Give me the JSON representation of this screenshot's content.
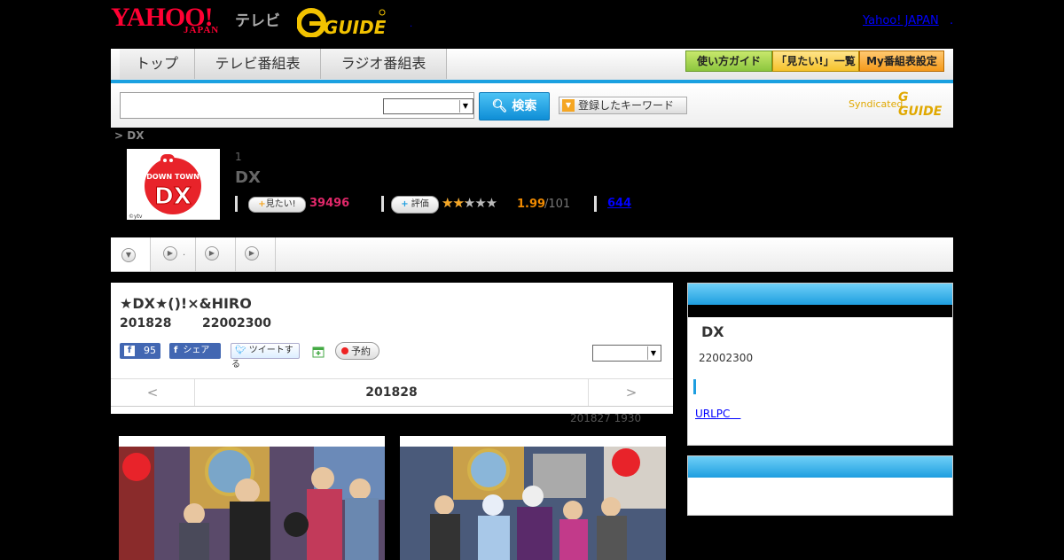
{
  "header": {
    "yahoo_logo": "YAHOO!",
    "japan_logo": "JAPAN",
    "tv_logo": "テレビ",
    "gguide_logo": "G GUIDE",
    "yahoo_japan_link": "Yahoo! JAPAN",
    "dot": ".",
    "dot2": "."
  },
  "nav": {
    "tabs": [
      "トップ",
      "テレビ番組表",
      "ラジオ番組表"
    ],
    "buttons": [
      "使い方ガイド",
      "「見たい!」一覧",
      "My番組表設定"
    ]
  },
  "search": {
    "button": "検索",
    "keyword_button": "登録したキーワード",
    "syndicated": "Syndicated",
    "syn_logo": "G GUIDE"
  },
  "breadcrumb": "> DX",
  "program": {
    "thumb_brand_top": "DOWN TOWN",
    "thumb_brand": "DX",
    "thumb_copyright": "©ytv",
    "number": "1",
    "title": "DX",
    "mitai_label": "見たい!",
    "mitai_count": "39496",
    "hyoka_label": "評価",
    "stars": "★★★★★",
    "score": "1.99",
    "score_total": "/101",
    "reviews": "644"
  },
  "tabs": {
    "tab2_label": "."
  },
  "episode": {
    "title": "★DX★()!×&HIRO",
    "date": "201828",
    "time": "22002300",
    "fb_like_count": "95",
    "fb_share": "シェア",
    "tweet": "ツイートする",
    "reserve": "予約"
  },
  "pager": {
    "prev": "<",
    "date": "201828",
    "next": ">"
  },
  "updated": "201827  1930",
  "sidebar": {
    "title": "DX",
    "time": "22002300",
    "link": "URLPC　"
  },
  "colors": {
    "accent_blue": "#1aa0e0",
    "mitai_pink": "#e2286a",
    "score_orange": "#f08a00"
  }
}
